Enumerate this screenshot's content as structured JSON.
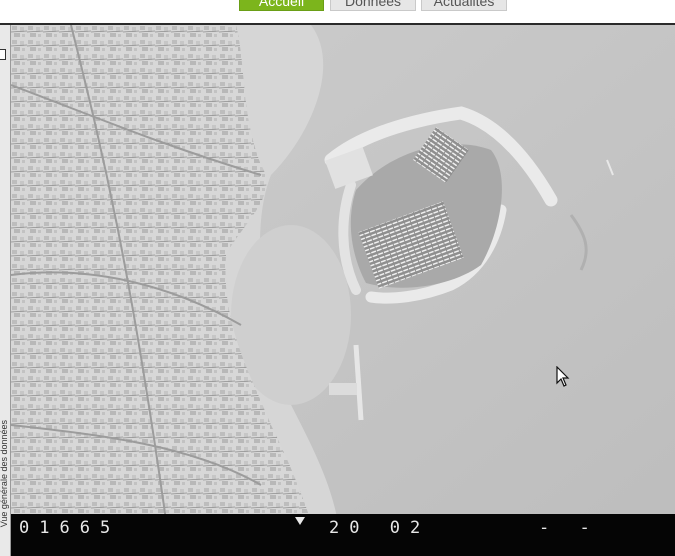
{
  "nav": {
    "tabs": [
      {
        "label": "Accueil",
        "active": true
      },
      {
        "label": "Données",
        "active": false
      },
      {
        "label": "Actualités",
        "active": false
      }
    ]
  },
  "sidebar": {
    "vertical_label": "Vue générale des données"
  },
  "photo_strip": {
    "frame_number": "01665",
    "date_code": "20 02",
    "trailing": "- -"
  },
  "colors": {
    "accent": "#7cb51c",
    "strip": "#050505"
  }
}
